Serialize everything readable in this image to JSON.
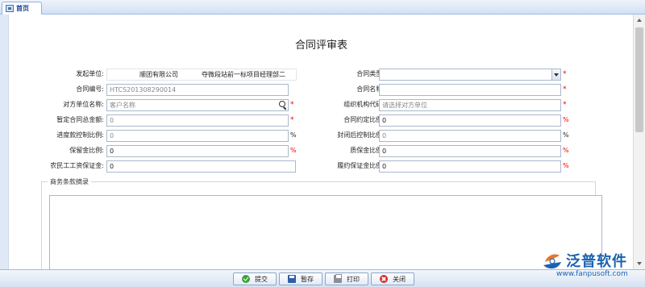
{
  "tab": {
    "label": "首页"
  },
  "form": {
    "title": "合同评审表",
    "fields": {
      "issuer": {
        "label": "发起单位:",
        "value": "顺团有限公司",
        "value2": "夺微段站前一标项目经理部二"
      },
      "contract_type": {
        "label": "合同类型:",
        "value": ""
      },
      "contract_no": {
        "label": "合同编号:",
        "value": "HTCS201308290014"
      },
      "contract_name": {
        "label": "合同名称:",
        "value": ""
      },
      "counterparty": {
        "label": "对方单位名称:",
        "placeholder": "客户名称"
      },
      "org_code": {
        "label": "组织机构代码:",
        "placeholder": "请选择对方单位"
      },
      "provisional_total": {
        "label": "暂定合同总金额:",
        "value": "0"
      },
      "agreed_ratio": {
        "label": "合同约定比例:",
        "value": "0"
      },
      "progress_ratio": {
        "label": "进度款控制比例:",
        "value": "0"
      },
      "post_seal_ratio": {
        "label": "封闭后控制比例:",
        "value": "0"
      },
      "retention_ratio": {
        "label": "保留金比例:",
        "value": "0"
      },
      "quality_ratio": {
        "label": "质保金比例:",
        "value": "0"
      },
      "wage_deposit": {
        "label": "农民工工资保证金:",
        "value": "0"
      },
      "performance_ratio": {
        "label": "履约保证金比例:",
        "value": "0"
      }
    },
    "required_mark": "*",
    "percent": "%",
    "commercial_terms_legend": "商务条款摘录"
  },
  "toolbar": {
    "submit": "提交",
    "save_draft": "暂存",
    "print": "打印",
    "close": "关闭"
  },
  "logo": {
    "cn": "泛普软件",
    "en": "www.fanpusoft.com"
  },
  "colors": {
    "accent": "#15428b",
    "required": "#e00000",
    "brand": "#1b63b0"
  }
}
